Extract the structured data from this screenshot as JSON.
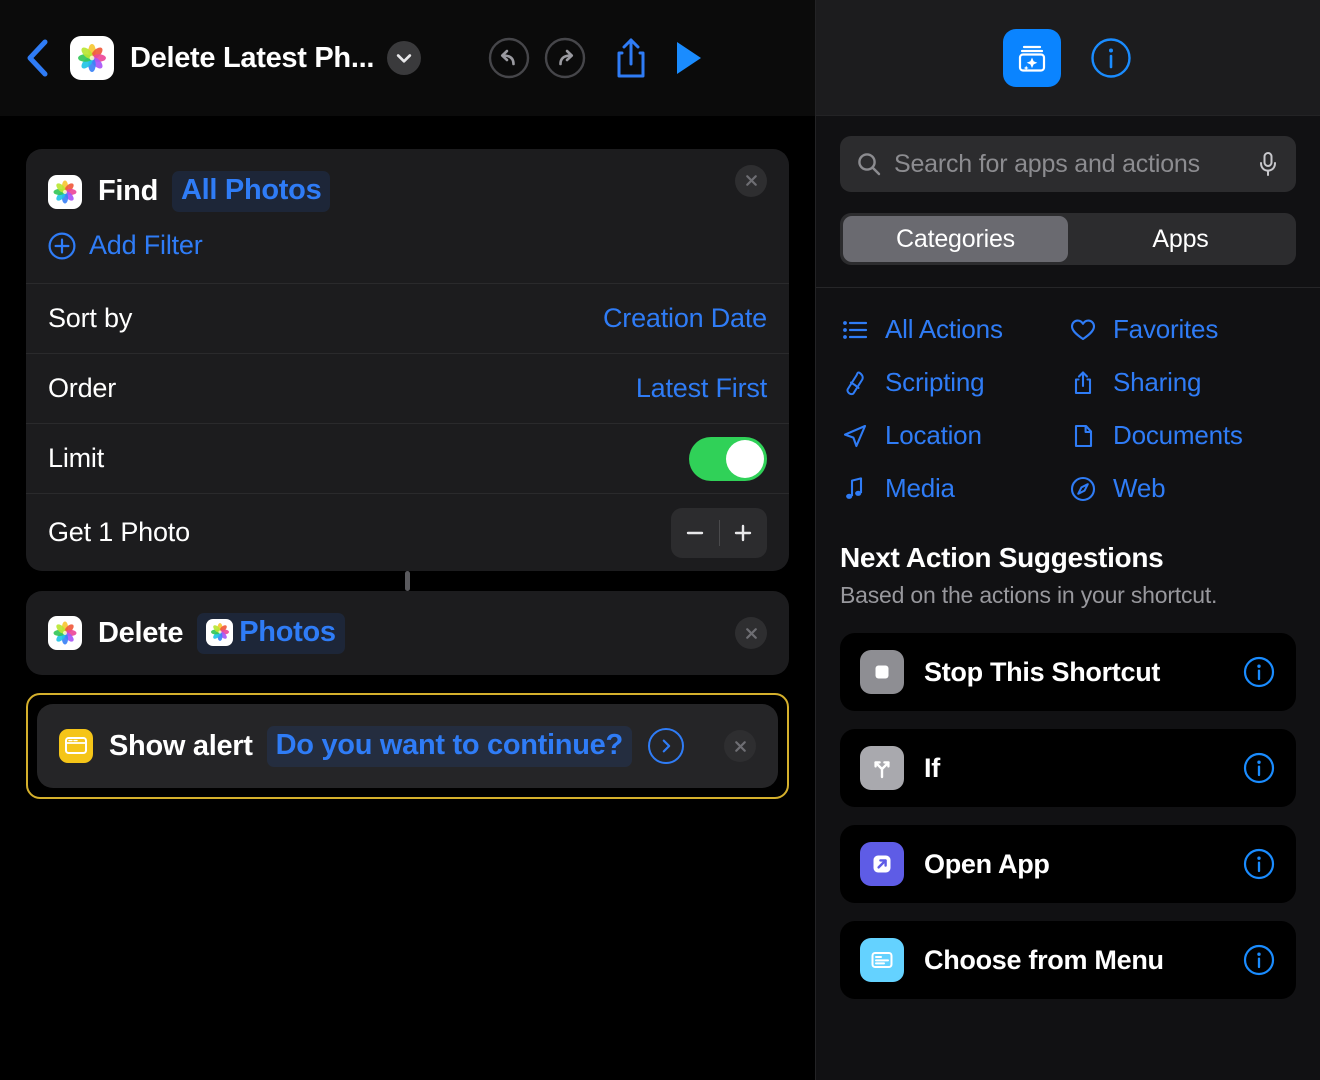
{
  "editor": {
    "toolbar": {
      "back_icon": "chevron-left-icon",
      "shortcut_icon": "photos-app-icon",
      "title": "Delete Latest Ph...",
      "chevron_icon": "chevron-down-icon",
      "undo_icon": "undo-icon",
      "redo_icon": "redo-icon",
      "share_icon": "share-icon",
      "play_icon": "play-icon"
    },
    "actions": [
      {
        "id": "find",
        "app_icon": "photos-app-icon",
        "verb": "Find",
        "token": "All Photos",
        "add_filter_label": "Add Filter",
        "params": [
          {
            "label": "Sort by",
            "value": "Creation Date",
            "type": "value"
          },
          {
            "label": "Order",
            "value": "Latest First",
            "type": "value"
          },
          {
            "label": "Limit",
            "value": "on",
            "type": "toggle"
          },
          {
            "label": "Get 1 Photo",
            "value": "",
            "type": "stepper",
            "minus": "−",
            "plus": "+"
          }
        ]
      },
      {
        "id": "delete",
        "app_icon": "photos-app-icon",
        "verb": "Delete",
        "token": "Photos",
        "token_icon": "photos-app-icon"
      },
      {
        "id": "show-alert",
        "app_icon": "alert-window-icon",
        "verb": "Show alert",
        "token": "Do you want to continue?",
        "selected": true,
        "disclosure_icon": "chevron-right-circle-icon"
      }
    ]
  },
  "library": {
    "header": {
      "library_icon": "action-library-icon",
      "info_icon": "info-circle-icon"
    },
    "search": {
      "placeholder": "Search for apps and actions",
      "value": "",
      "search_icon": "search-icon",
      "mic_icon": "microphone-icon"
    },
    "segments": [
      {
        "label": "Categories",
        "active": true
      },
      {
        "label": "Apps",
        "active": false
      }
    ],
    "categories": [
      {
        "label": "All Actions",
        "icon": "list-bullet-icon"
      },
      {
        "label": "Favorites",
        "icon": "heart-icon"
      },
      {
        "label": "Scripting",
        "icon": "scripting-icon"
      },
      {
        "label": "Sharing",
        "icon": "share-icon"
      },
      {
        "label": "Location",
        "icon": "paper-plane-icon"
      },
      {
        "label": "Documents",
        "icon": "document-icon"
      },
      {
        "label": "Media",
        "icon": "music-note-icon"
      },
      {
        "label": "Web",
        "icon": "compass-icon"
      }
    ],
    "suggestions": {
      "title": "Next Action Suggestions",
      "subtitle": "Based on the actions in your shortcut.",
      "items": [
        {
          "label": "Stop This Shortcut",
          "icon": "stop-square-icon",
          "icon_color": "#8e8e93",
          "info_icon": "info-circle-icon"
        },
        {
          "label": "If",
          "icon": "branch-fork-icon",
          "icon_color": "#a9a9ae",
          "info_icon": "info-circle-icon"
        },
        {
          "label": "Open App",
          "icon": "open-app-arrow-icon",
          "icon_color": "#5e5ce6",
          "info_icon": "info-circle-icon"
        },
        {
          "label": "Choose from Menu",
          "icon": "menu-card-icon",
          "icon_color": "#64d2ff",
          "info_icon": "info-circle-icon"
        }
      ]
    }
  },
  "colors": {
    "accent_blue": "#2f7cf6",
    "toggle_green": "#30d158",
    "selection_gold": "#d5b02c",
    "library_blue": "#0a84ff"
  }
}
